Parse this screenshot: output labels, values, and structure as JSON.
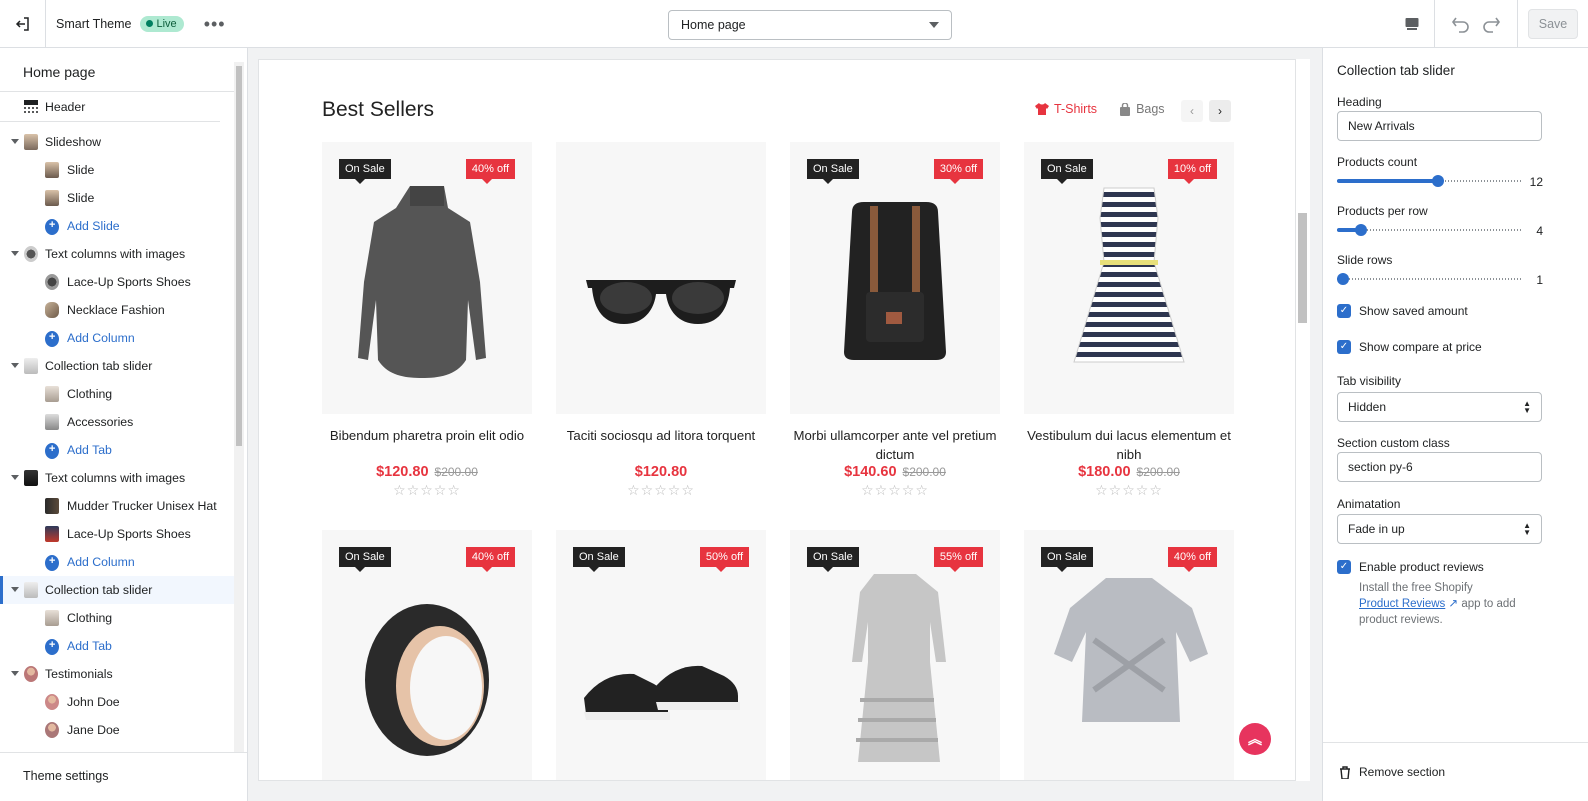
{
  "topbar": {
    "theme_name": "Smart Theme",
    "live_label": "Live",
    "more_label": "•••",
    "page_select": "Home page",
    "save_label": "Save"
  },
  "left": {
    "title": "Home page",
    "footer": "Theme settings",
    "items": [
      {
        "label": "Slideshow",
        "children": [
          "Slide",
          "Slide"
        ],
        "add": "Add Slide"
      },
      {
        "label": "Text columns with images",
        "children": [
          "Lace-Up Sports Shoes",
          "Necklace Fashion"
        ],
        "add": "Add Column"
      },
      {
        "label": "Collection tab slider",
        "children": [
          "Clothing",
          "Accessories"
        ],
        "add": "Add Tab"
      },
      {
        "label": "Text columns with images",
        "children": [
          "Mudder Trucker Unisex Hat",
          "Lace-Up Sports Shoes"
        ],
        "add": "Add Column"
      },
      {
        "label": "Collection tab slider",
        "children": [
          "Clothing"
        ],
        "add": "Add Tab"
      },
      {
        "label": "Testimonials",
        "children": [
          "John Doe",
          "Jane Doe"
        ]
      }
    ],
    "header_label": "Header"
  },
  "preview": {
    "title": "Best Sellers",
    "tabs": [
      "T-Shirts",
      "Bags"
    ],
    "products": [
      {
        "sale": "On Sale",
        "off": "40% off",
        "name": "Bibendum pharetra proin elit odio",
        "price": "$120.80",
        "compare": "$200.00"
      },
      {
        "sale": "",
        "off": "",
        "name": "Taciti sociosqu ad litora torquent",
        "price": "$120.80",
        "compare": ""
      },
      {
        "sale": "On Sale",
        "off": "30% off",
        "name": "Morbi ullamcorper ante vel pretium dictum",
        "price": "$140.60",
        "compare": "$200.00"
      },
      {
        "sale": "On Sale",
        "off": "10% off",
        "name": "Vestibulum dui lacus elementum et nibh",
        "price": "$180.00",
        "compare": "$200.00"
      },
      {
        "sale": "On Sale",
        "off": "40% off"
      },
      {
        "sale": "On Sale",
        "off": "50% off"
      },
      {
        "sale": "On Sale",
        "off": "55% off"
      },
      {
        "sale": "On Sale",
        "off": "40% off"
      }
    ],
    "stars": "☆☆☆☆☆"
  },
  "right": {
    "title": "Collection tab slider",
    "heading_label": "Heading",
    "heading_value": "New Arrivals",
    "products_count_label": "Products count",
    "products_count": 12,
    "per_row_label": "Products per row",
    "per_row": 4,
    "slide_rows_label": "Slide rows",
    "slide_rows": 1,
    "show_saved": "Show saved amount",
    "show_compare": "Show compare at price",
    "tab_visibility_label": "Tab visibility",
    "tab_visibility": "Hidden",
    "custom_class_label": "Section custom class",
    "custom_class": "section py-6",
    "animation_label": "Animatation",
    "animation": "Fade in up",
    "enable_reviews": "Enable product reviews",
    "help_pre": "Install the free Shopify",
    "help_link": "Product Reviews",
    "help_post": " app to add product reviews.",
    "remove": "Remove section"
  },
  "colors": {
    "accent": "#2c6ecb",
    "sale_red": "#e7343f",
    "fab": "#e7345e"
  }
}
